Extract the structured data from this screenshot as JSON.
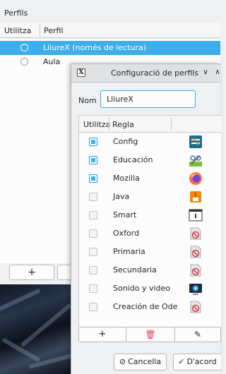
{
  "background_window": {
    "title": "Perfils",
    "columns": [
      "Utilitza",
      "Perfil"
    ],
    "profiles": [
      {
        "label": "LliureX (només de lectura)",
        "selected": true
      },
      {
        "label": "Aula",
        "selected": false
      }
    ],
    "add_button": "+"
  },
  "dialog": {
    "title": "Configuració de perfils",
    "titlebar_buttons": {
      "minimize": "∨",
      "maximize": "∧"
    },
    "name_label": "Nom",
    "name_value": "LliureX",
    "columns": [
      "Utilitza",
      "Regla"
    ],
    "rules": [
      {
        "label": "Config",
        "checked": true,
        "icon": "config-icon"
      },
      {
        "label": "Educación",
        "checked": true,
        "icon": "education-icon"
      },
      {
        "label": "Mozilla",
        "checked": true,
        "icon": "firefox-icon"
      },
      {
        "label": "Java",
        "checked": false,
        "icon": "java-icon"
      },
      {
        "label": "Smart",
        "checked": false,
        "icon": "smart-icon"
      },
      {
        "label": "Oxford",
        "checked": false,
        "icon": "forbidden-icon"
      },
      {
        "label": "Primaria",
        "checked": false,
        "icon": "forbidden-icon"
      },
      {
        "label": "Secundaria",
        "checked": false,
        "icon": "forbidden-icon"
      },
      {
        "label": "Sonido y video",
        "checked": false,
        "icon": "multimedia-icon"
      },
      {
        "label": "Creación de Ode",
        "checked": false,
        "icon": "forbidden-icon"
      }
    ],
    "toolbar": {
      "add": "+",
      "delete": "🗑",
      "edit": "✎"
    },
    "cancel_label": "Cancella",
    "cancel_glyph": "⊘",
    "ok_label": "D'acord",
    "ok_glyph": "✓"
  },
  "colors": {
    "accent": "#3daee9",
    "checkbox_on": "#3daee9",
    "danger": "#da4453"
  }
}
